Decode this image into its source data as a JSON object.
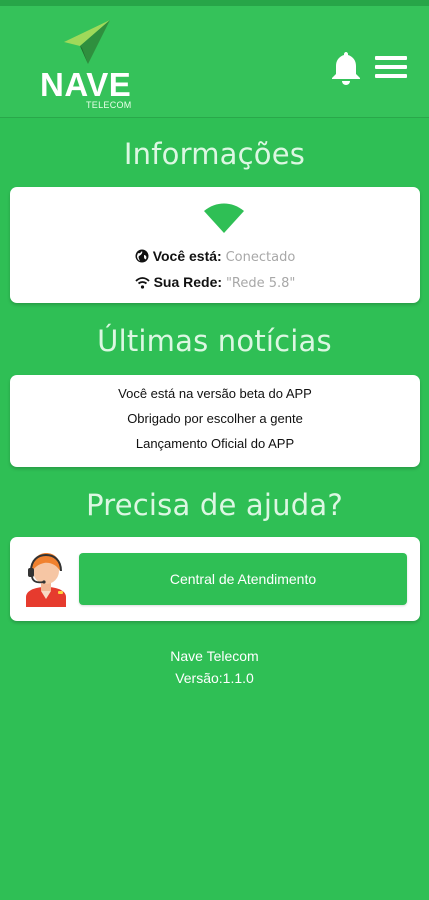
{
  "colors": {
    "brand_green": "#2fbf55",
    "card_bg": "#ffffff",
    "muted_value": "#a8a8a8"
  },
  "header": {
    "logo_text": "NAVE",
    "logo_subtext": "TELECOM",
    "icons": [
      "bell-icon",
      "hamburger-menu-icon"
    ]
  },
  "info": {
    "title": "Informações",
    "status_label": "Você está:",
    "status_value": "Conectado",
    "network_label": "Sua Rede:",
    "network_value": "\"Rede 5.8\""
  },
  "news": {
    "title": "Últimas notícias",
    "items": [
      "Você está na versão beta do APP",
      "Obrigado por escolher a gente",
      "Lançamento Oficial do APP"
    ]
  },
  "help": {
    "title": "Precisa de ajuda?",
    "button_label": "Central de Atendimento"
  },
  "footer": {
    "company": "Nave Telecom",
    "version": "Versão:1.1.0"
  }
}
